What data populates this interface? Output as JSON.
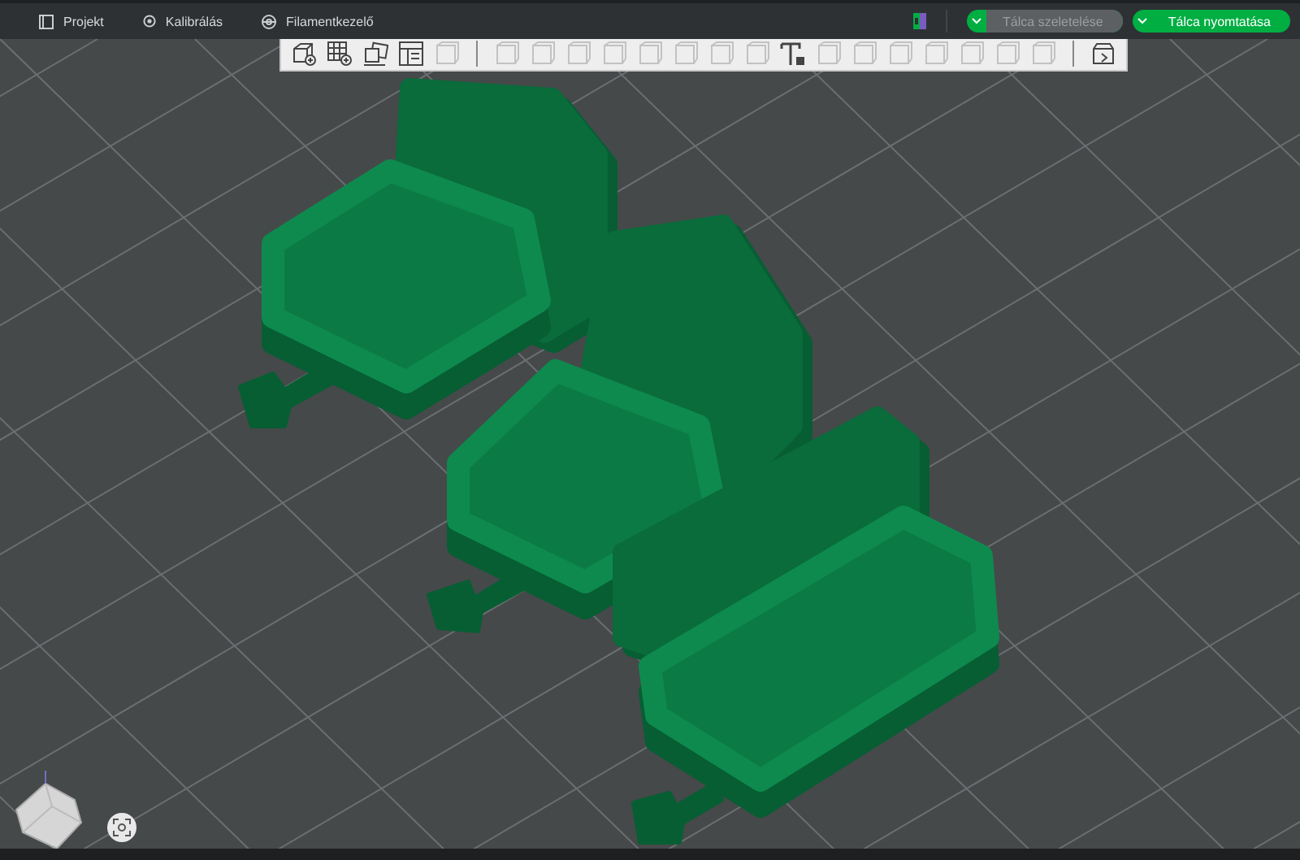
{
  "menu": [
    {
      "label": "Projekt",
      "kind": "document"
    },
    {
      "label": "Kalibrálás",
      "kind": "target"
    },
    {
      "label": "Filamentkezelő",
      "kind": "spool"
    }
  ],
  "slice_button": {
    "label": "Tálca szeletelése",
    "disabled": true
  },
  "print_button": {
    "label": "Tálca nyomtatása",
    "disabled": false
  },
  "toolbar": {
    "tools": [
      {
        "kind": "cube-plus",
        "disabled": false
      },
      {
        "kind": "grid-plus",
        "disabled": false
      },
      {
        "kind": "images",
        "disabled": false
      },
      {
        "kind": "panel",
        "disabled": false
      },
      {
        "kind": "generic",
        "disabled": true
      },
      {
        "kind": "separator"
      },
      {
        "kind": "generic",
        "disabled": true
      },
      {
        "kind": "generic",
        "disabled": true
      },
      {
        "kind": "generic",
        "disabled": true
      },
      {
        "kind": "generic",
        "disabled": true
      },
      {
        "kind": "generic",
        "disabled": true
      },
      {
        "kind": "generic",
        "disabled": true
      },
      {
        "kind": "generic",
        "disabled": true
      },
      {
        "kind": "generic",
        "disabled": true
      },
      {
        "kind": "text",
        "disabled": false
      },
      {
        "kind": "generic",
        "disabled": true
      },
      {
        "kind": "generic",
        "disabled": true
      },
      {
        "kind": "generic",
        "disabled": true
      },
      {
        "kind": "generic",
        "disabled": true
      },
      {
        "kind": "generic",
        "disabled": true
      },
      {
        "kind": "generic",
        "disabled": true
      },
      {
        "kind": "generic",
        "disabled": true
      },
      {
        "kind": "separator"
      },
      {
        "kind": "box-arrow",
        "disabled": false
      }
    ]
  }
}
